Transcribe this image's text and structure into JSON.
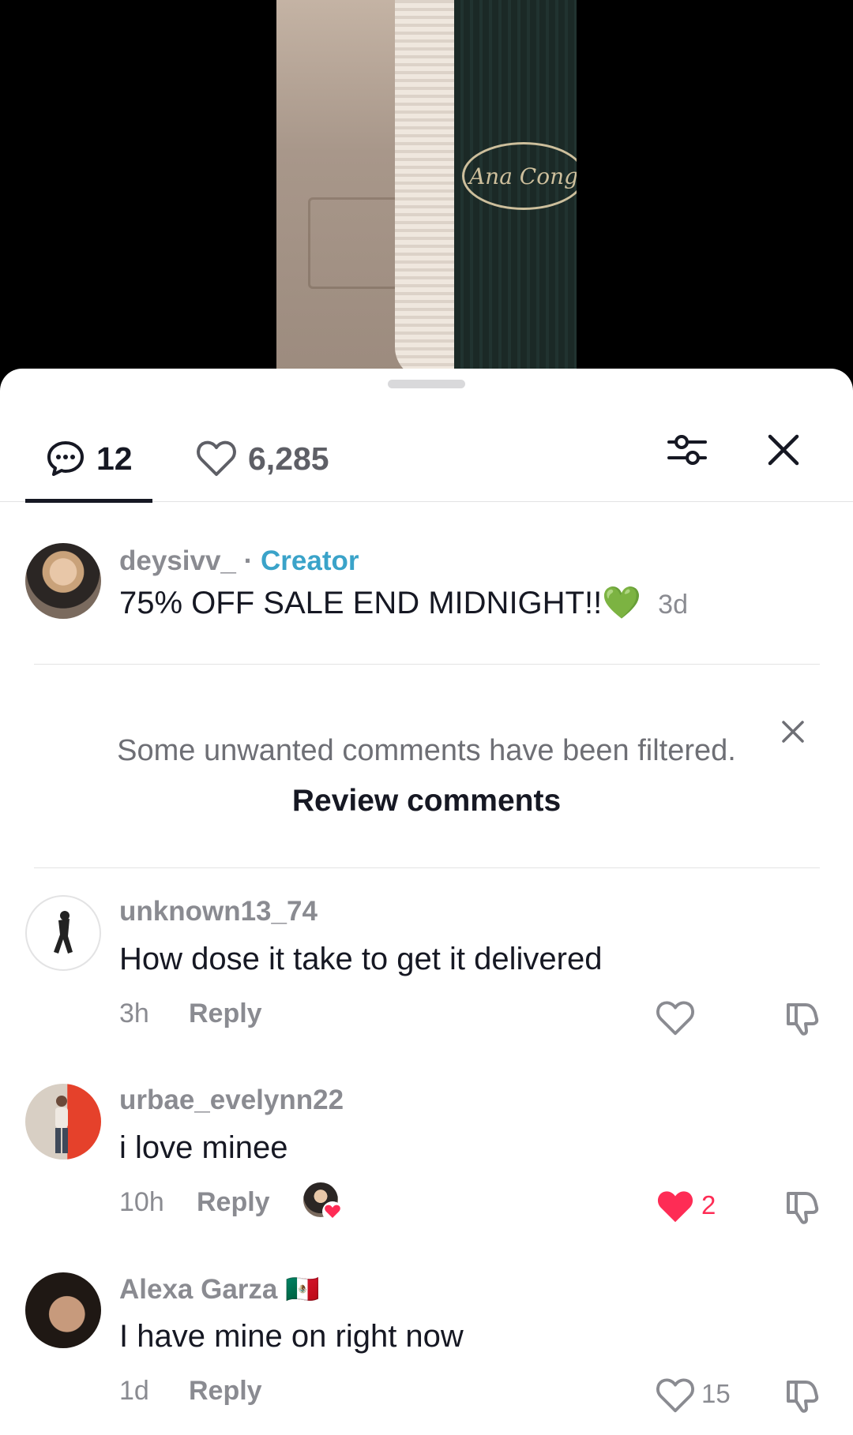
{
  "tabs": {
    "comments_count": "12",
    "likes_count": "6,285"
  },
  "video": {
    "logo_text": "Ana Cong"
  },
  "creator_comment": {
    "username": "deysivv_",
    "separator": "·",
    "badge": "Creator",
    "text": "75% OFF SALE END MIDNIGHT!!",
    "emoji": "💚",
    "time": "3d"
  },
  "filter_notice": {
    "text": "Some unwanted comments have been filtered.",
    "link": "Review comments"
  },
  "comments": [
    {
      "username": "unknown13_74",
      "text": "How dose it take to get it delivered",
      "time": "3h",
      "reply": "Reply",
      "likes": ""
    },
    {
      "username": "urbae_evelynn22",
      "text": "i love minee",
      "time": "10h",
      "reply": "Reply",
      "likes": "2"
    },
    {
      "username": "Alexa Garza",
      "flag": "🇲🇽",
      "text": "I have mine on right now",
      "time": "1d",
      "reply": "Reply",
      "likes": "15"
    }
  ],
  "icons": {
    "comments_tab": "comment-bubble-icon",
    "likes_tab": "heart-outline-icon",
    "filter": "sliders-icon",
    "close": "close-icon",
    "like": "heart-icon",
    "dislike": "thumbs-down-icon"
  },
  "colors": {
    "creator_badge": "#3aa3c9",
    "like_active": "#fe2c55",
    "text_muted": "#8a8b91"
  }
}
